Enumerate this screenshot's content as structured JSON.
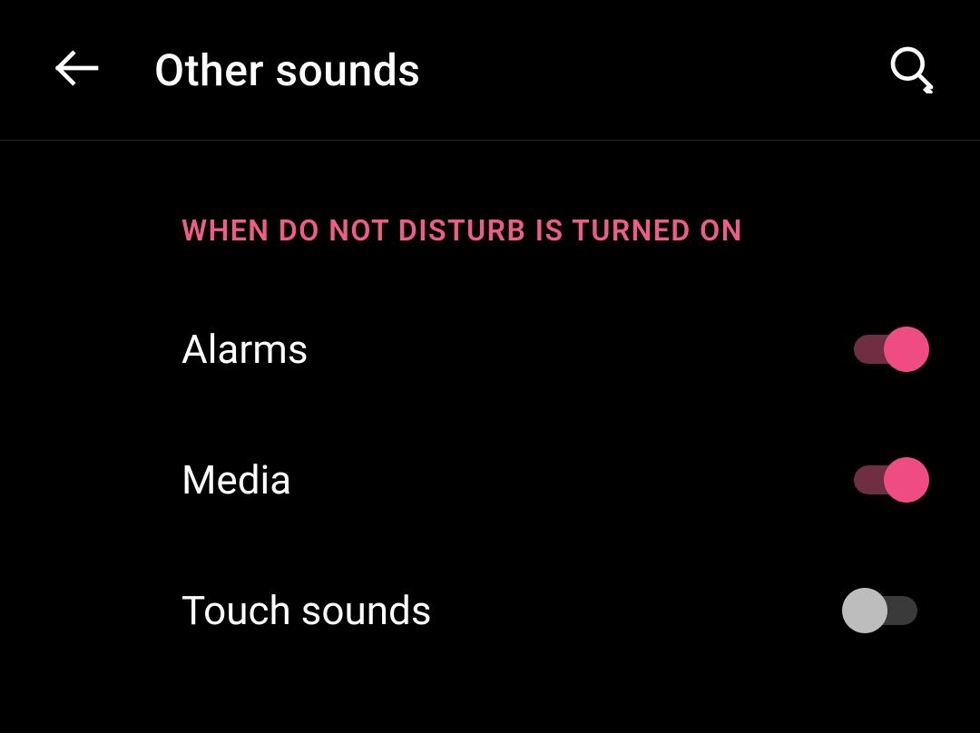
{
  "header": {
    "title": "Other sounds"
  },
  "section": {
    "header": "WHEN DO NOT DISTURB IS TURNED ON",
    "items": [
      {
        "label": "Alarms",
        "enabled": true
      },
      {
        "label": "Media",
        "enabled": true
      },
      {
        "label": "Touch sounds",
        "enabled": false
      }
    ]
  },
  "colors": {
    "accent": "#EE4C83",
    "accent_header": "#ED5D85"
  }
}
